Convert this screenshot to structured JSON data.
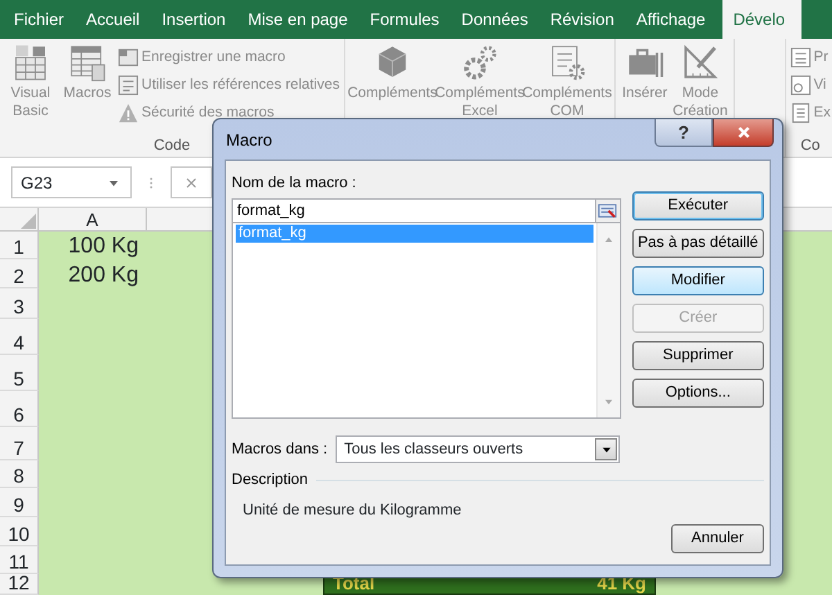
{
  "ribbon_tabs": [
    {
      "label": "Fichier",
      "selected": false
    },
    {
      "label": "Accueil",
      "selected": false
    },
    {
      "label": "Insertion",
      "selected": false
    },
    {
      "label": "Mise en page",
      "selected": false
    },
    {
      "label": "Formules",
      "selected": false
    },
    {
      "label": "Données",
      "selected": false
    },
    {
      "label": "Révision",
      "selected": false
    },
    {
      "label": "Affichage",
      "selected": false
    },
    {
      "label": "Dévelo",
      "selected": true
    }
  ],
  "ribbon_groups": [
    {
      "label": "Code",
      "items": [
        {
          "kind": "large",
          "label": "Visual Basic"
        },
        {
          "kind": "large",
          "label": "Macros"
        },
        {
          "kind": "small",
          "label": "Enregistrer une macro"
        },
        {
          "kind": "small",
          "label": "Utiliser les références relatives"
        },
        {
          "kind": "small",
          "label": "Sécurité des macros"
        }
      ]
    },
    {
      "items": [
        {
          "kind": "large",
          "label": "Compléments"
        },
        {
          "kind": "large",
          "label": "Compléments Excel"
        },
        {
          "kind": "large",
          "label": "Compléments COM"
        }
      ]
    },
    {
      "items": [
        {
          "kind": "large",
          "label": "Insérer"
        },
        {
          "kind": "large",
          "label": "Mode Création"
        }
      ]
    },
    {
      "label": "Co",
      "items": [
        {
          "kind": "small",
          "label": "Pr"
        },
        {
          "kind": "small",
          "label": "Vi"
        },
        {
          "kind": "small",
          "label": "Ex"
        }
      ]
    }
  ],
  "name_box": "G23",
  "sheet": {
    "columns": [
      "A"
    ],
    "rows": [
      {
        "number": "1",
        "cell": "100 Kg"
      },
      {
        "number": "2",
        "cell": "200 Kg"
      },
      {
        "number": "3"
      },
      {
        "number": "4"
      },
      {
        "number": "5"
      },
      {
        "number": "6"
      },
      {
        "number": "7"
      },
      {
        "number": "8"
      },
      {
        "number": "9"
      },
      {
        "number": "10"
      },
      {
        "number": "11"
      },
      {
        "number": "12"
      }
    ],
    "total_row": {
      "label": "Total",
      "value": "41 Kg"
    }
  },
  "dialog": {
    "title": "Macro",
    "help": "?",
    "name_label": "Nom de la macro :",
    "name_value": "format_kg",
    "macros": [
      {
        "name": "format_kg",
        "selected": true
      }
    ],
    "buttons": [
      {
        "label": "Exécuter",
        "focused": true,
        "hot": false,
        "disabled": false
      },
      {
        "label": "Pas à pas détaillé",
        "focused": false,
        "hot": false,
        "disabled": false
      },
      {
        "label": "Modifier",
        "focused": false,
        "hot": true,
        "disabled": false
      },
      {
        "label": "Créer",
        "focused": false,
        "hot": false,
        "disabled": true
      },
      {
        "label": "Supprimer",
        "focused": false,
        "hot": false,
        "disabled": false
      },
      {
        "label": "Options...",
        "focused": false,
        "hot": false,
        "disabled": false
      }
    ],
    "macros_in_label": "Macros dans :",
    "macros_in_value": "Tous les classeurs ouverts",
    "description_label": "Description",
    "description": "Unité de mesure du Kilogramme",
    "cancel": "Annuler"
  }
}
